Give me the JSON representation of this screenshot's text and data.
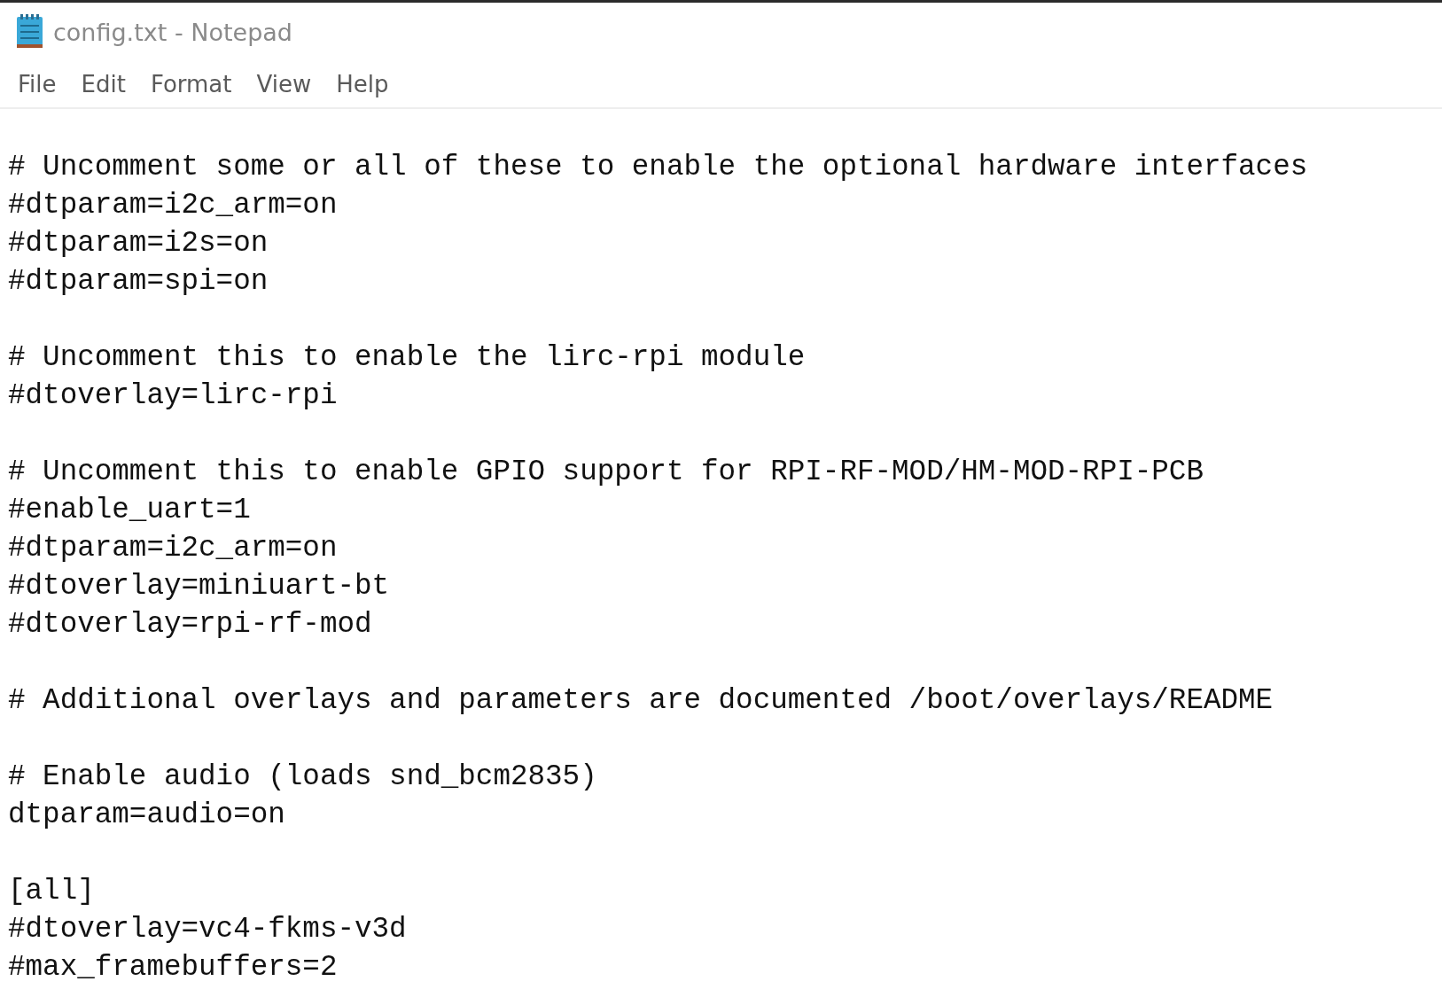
{
  "window": {
    "title": "config.txt - Notepad"
  },
  "menu": [
    "File",
    "Edit",
    "Format",
    "View",
    "Help"
  ],
  "editor": {
    "blocks": [
      [
        "# Uncomment some or all of these to enable the optional hardware interfaces",
        "#dtparam=i2c_arm=on",
        "#dtparam=i2s=on",
        "#dtparam=spi=on"
      ],
      [
        "# Uncomment this to enable the lirc-rpi module",
        "#dtoverlay=lirc-rpi"
      ],
      [
        "# Uncomment this to enable GPIO support for RPI-RF-MOD/HM-MOD-RPI-PCB",
        "#enable_uart=1",
        "#dtparam=i2c_arm=on",
        "#dtoverlay=miniuart-bt",
        "#dtoverlay=rpi-rf-mod"
      ],
      [
        "# Additional overlays and parameters are documented /boot/overlays/README"
      ],
      [
        "# Enable audio (loads snd_bcm2835)",
        "dtparam=audio=on"
      ],
      [
        "[all]",
        "#dtoverlay=vc4-fkms-v3d",
        "#max_framebuffers=2"
      ]
    ]
  }
}
